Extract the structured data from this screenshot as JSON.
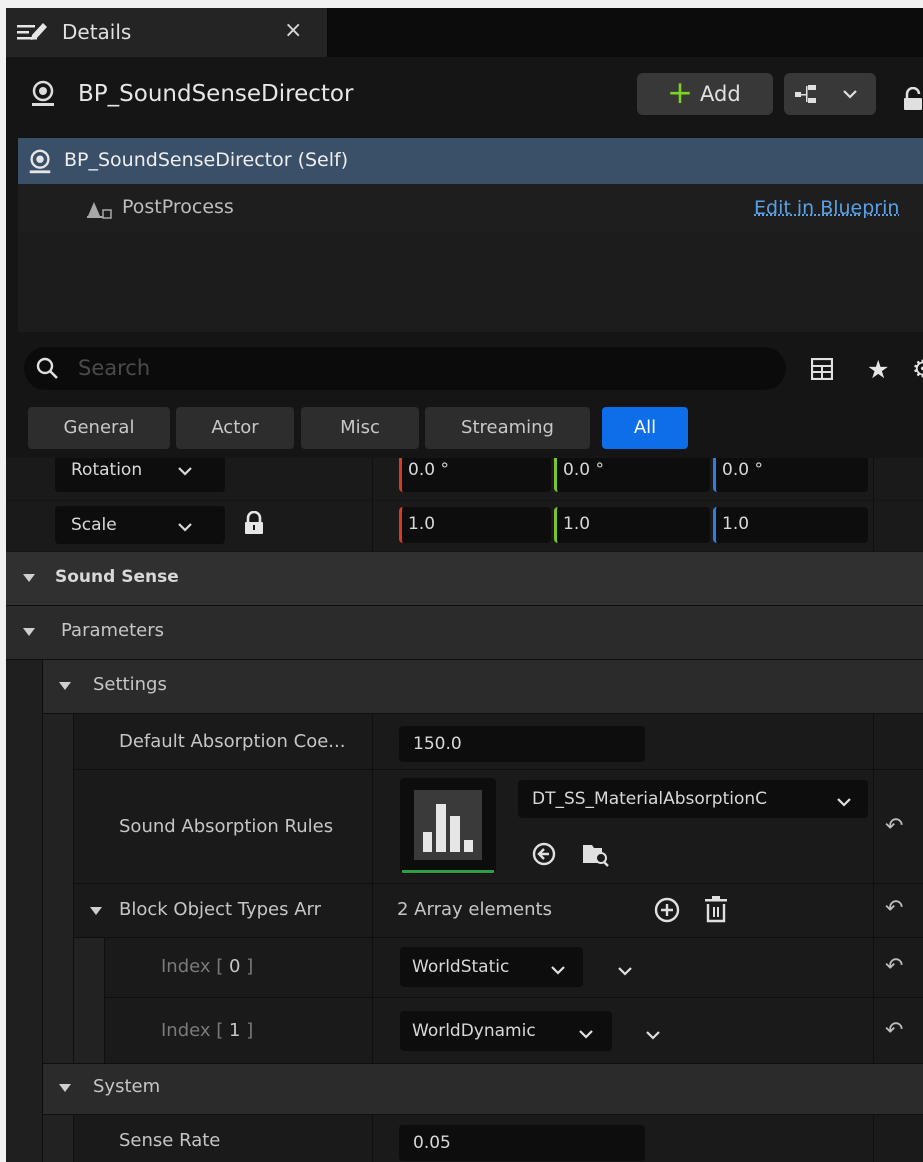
{
  "tab": {
    "title": "Details",
    "close": "×"
  },
  "header": {
    "title": "BP_SoundSenseDirector",
    "add_label": "Add",
    "add_symbol": "+"
  },
  "tree": {
    "self_label": "BP_SoundSenseDirector (Self)",
    "component_label": "PostProcess",
    "edit_link": "Edit in Blueprin"
  },
  "search": {
    "placeholder": "Search"
  },
  "filters": [
    "General",
    "Actor",
    "Misc",
    "Streaming",
    "All"
  ],
  "transform": {
    "rotation": {
      "label": "Rotation",
      "x": "0.0 °",
      "y": "0.0 °",
      "z": "0.0 °"
    },
    "scale": {
      "label": "Scale",
      "x": "1.0",
      "y": "1.0",
      "z": "1.0"
    }
  },
  "sections": {
    "sound_sense": "Sound Sense",
    "parameters": "Parameters",
    "settings": "Settings",
    "system": "System"
  },
  "props": {
    "default_absorption": {
      "label": "Default Absorption Coe...",
      "value": "150.0"
    },
    "sound_absorption_rules": {
      "label": "Sound Absorption Rules",
      "asset": "DT_SS_MaterialAbsorptionC"
    },
    "block_object_types": {
      "label": "Block Object Types Arr",
      "summary": "2 Array elements",
      "items": [
        {
          "index_prefix": "Index [ ",
          "index": "0",
          "index_suffix": " ]",
          "value": "WorldStatic"
        },
        {
          "index_prefix": "Index [ ",
          "index": "1",
          "index_suffix": " ]",
          "value": "WorldDynamic"
        }
      ]
    },
    "sense_rate": {
      "label": "Sense Rate",
      "value": "0.05"
    }
  },
  "colors": {
    "accent_blue": "#0e6de8",
    "selection": "#3a5068",
    "axis_x": "#d83a22",
    "axis_y": "#7cc42a",
    "axis_z": "#2a7fe0",
    "green_underline": "#2ea043"
  }
}
